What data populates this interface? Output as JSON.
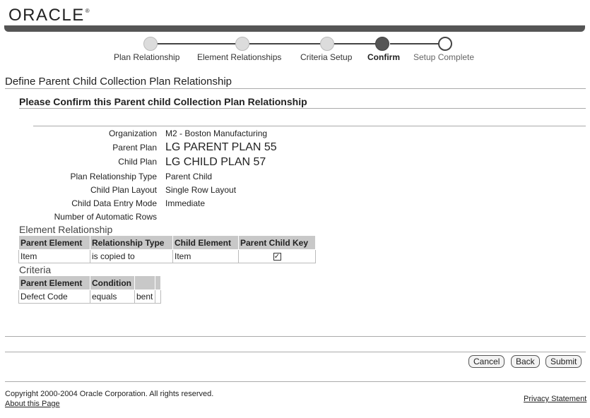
{
  "branding": {
    "logo_text": "ORACLE",
    "logo_mark": "®"
  },
  "train": {
    "steps": [
      {
        "label": "Plan Relationship",
        "state": "done"
      },
      {
        "label": "Element Relationships",
        "state": "done"
      },
      {
        "label": "Criteria Setup",
        "state": "done"
      },
      {
        "label": "Confirm",
        "state": "current"
      },
      {
        "label": "Setup Complete",
        "state": "future"
      }
    ]
  },
  "page": {
    "title": "Define Parent Child Collection Plan Relationship",
    "subtitle": "Please Confirm this Parent child Collection Plan Relationship"
  },
  "fields": [
    {
      "label": "Organization",
      "value": "M2 - Boston Manufacturing"
    },
    {
      "label": "Parent Plan",
      "value": "LG PARENT PLAN 55"
    },
    {
      "label": "Child Plan",
      "value": "LG CHILD PLAN 57"
    },
    {
      "label": "Plan Relationship Type",
      "value": "Parent Child"
    },
    {
      "label": "Child Plan Layout",
      "value": "Single Row Layout"
    },
    {
      "label": "Child Data Entry Mode",
      "value": "Immediate"
    },
    {
      "label": "Number of Automatic Rows",
      "value": ""
    }
  ],
  "element_relationship": {
    "heading": "Element Relationship",
    "columns": [
      "Parent Element",
      "Relationship Type",
      "Child Element",
      "Parent Child Key"
    ],
    "rows": [
      {
        "parent_element": "Item",
        "relationship_type": "is copied to",
        "child_element": "Item",
        "parent_child_key": true
      }
    ]
  },
  "criteria": {
    "heading": "Criteria",
    "columns": [
      "Parent Element",
      "Condition",
      "",
      ""
    ],
    "rows": [
      {
        "parent_element": "Defect Code",
        "condition": "equals",
        "value": "bent",
        "extra": ""
      }
    ]
  },
  "buttons": {
    "cancel": "Cancel",
    "back": "Back",
    "submit": "Submit"
  },
  "footer": {
    "copyright": "Copyright 2000-2004 Oracle Corporation. All rights reserved.",
    "about_link": "About this Page",
    "privacy_link": "Privacy Statement"
  }
}
